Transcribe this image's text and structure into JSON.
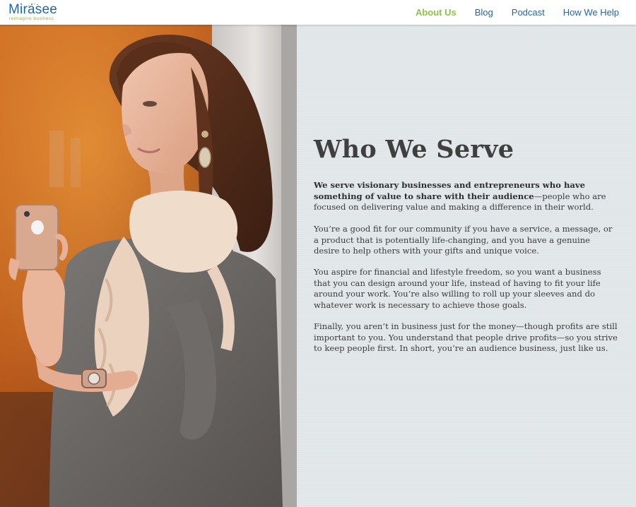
{
  "header": {
    "logo": {
      "name": "Mirasee",
      "tagline": "reimagine business"
    },
    "nav": [
      {
        "label": "About Us",
        "active": true
      },
      {
        "label": "Blog",
        "active": false
      },
      {
        "label": "Podcast",
        "active": false
      },
      {
        "label": "How We Help",
        "active": false
      }
    ]
  },
  "main": {
    "heading": "Who We Serve",
    "paragraphs": [
      {
        "bold": "We serve visionary businesses and entrepreneurs who have something of value to share with their audience",
        "text": "—people who are focused on delivering value and making a difference in their world."
      },
      {
        "text": "You’re a good fit for our community if you have a service, a message, or a product that is potentially life-changing, and you have a genuine desire to help others with your gifts and unique voice."
      },
      {
        "text": "You aspire for financial and lifestyle freedom, so you want a business that you can design around your life, instead of having to fit your life around your work. You’re also willing to roll up your sleeves and do whatever work is necessary to achieve those goals."
      },
      {
        "text": "Finally, you aren’t in business just for the money—though profits are still important to you. You understand that people drive profits—so you strive to keep people first. In short, you’re an audience business, just like us."
      }
    ]
  },
  "colors": {
    "brand_blue": "#1d67ad",
    "accent_green": "#8cc63f",
    "panel_bg": "#e3e8ea",
    "text": "#3a3a3a"
  }
}
